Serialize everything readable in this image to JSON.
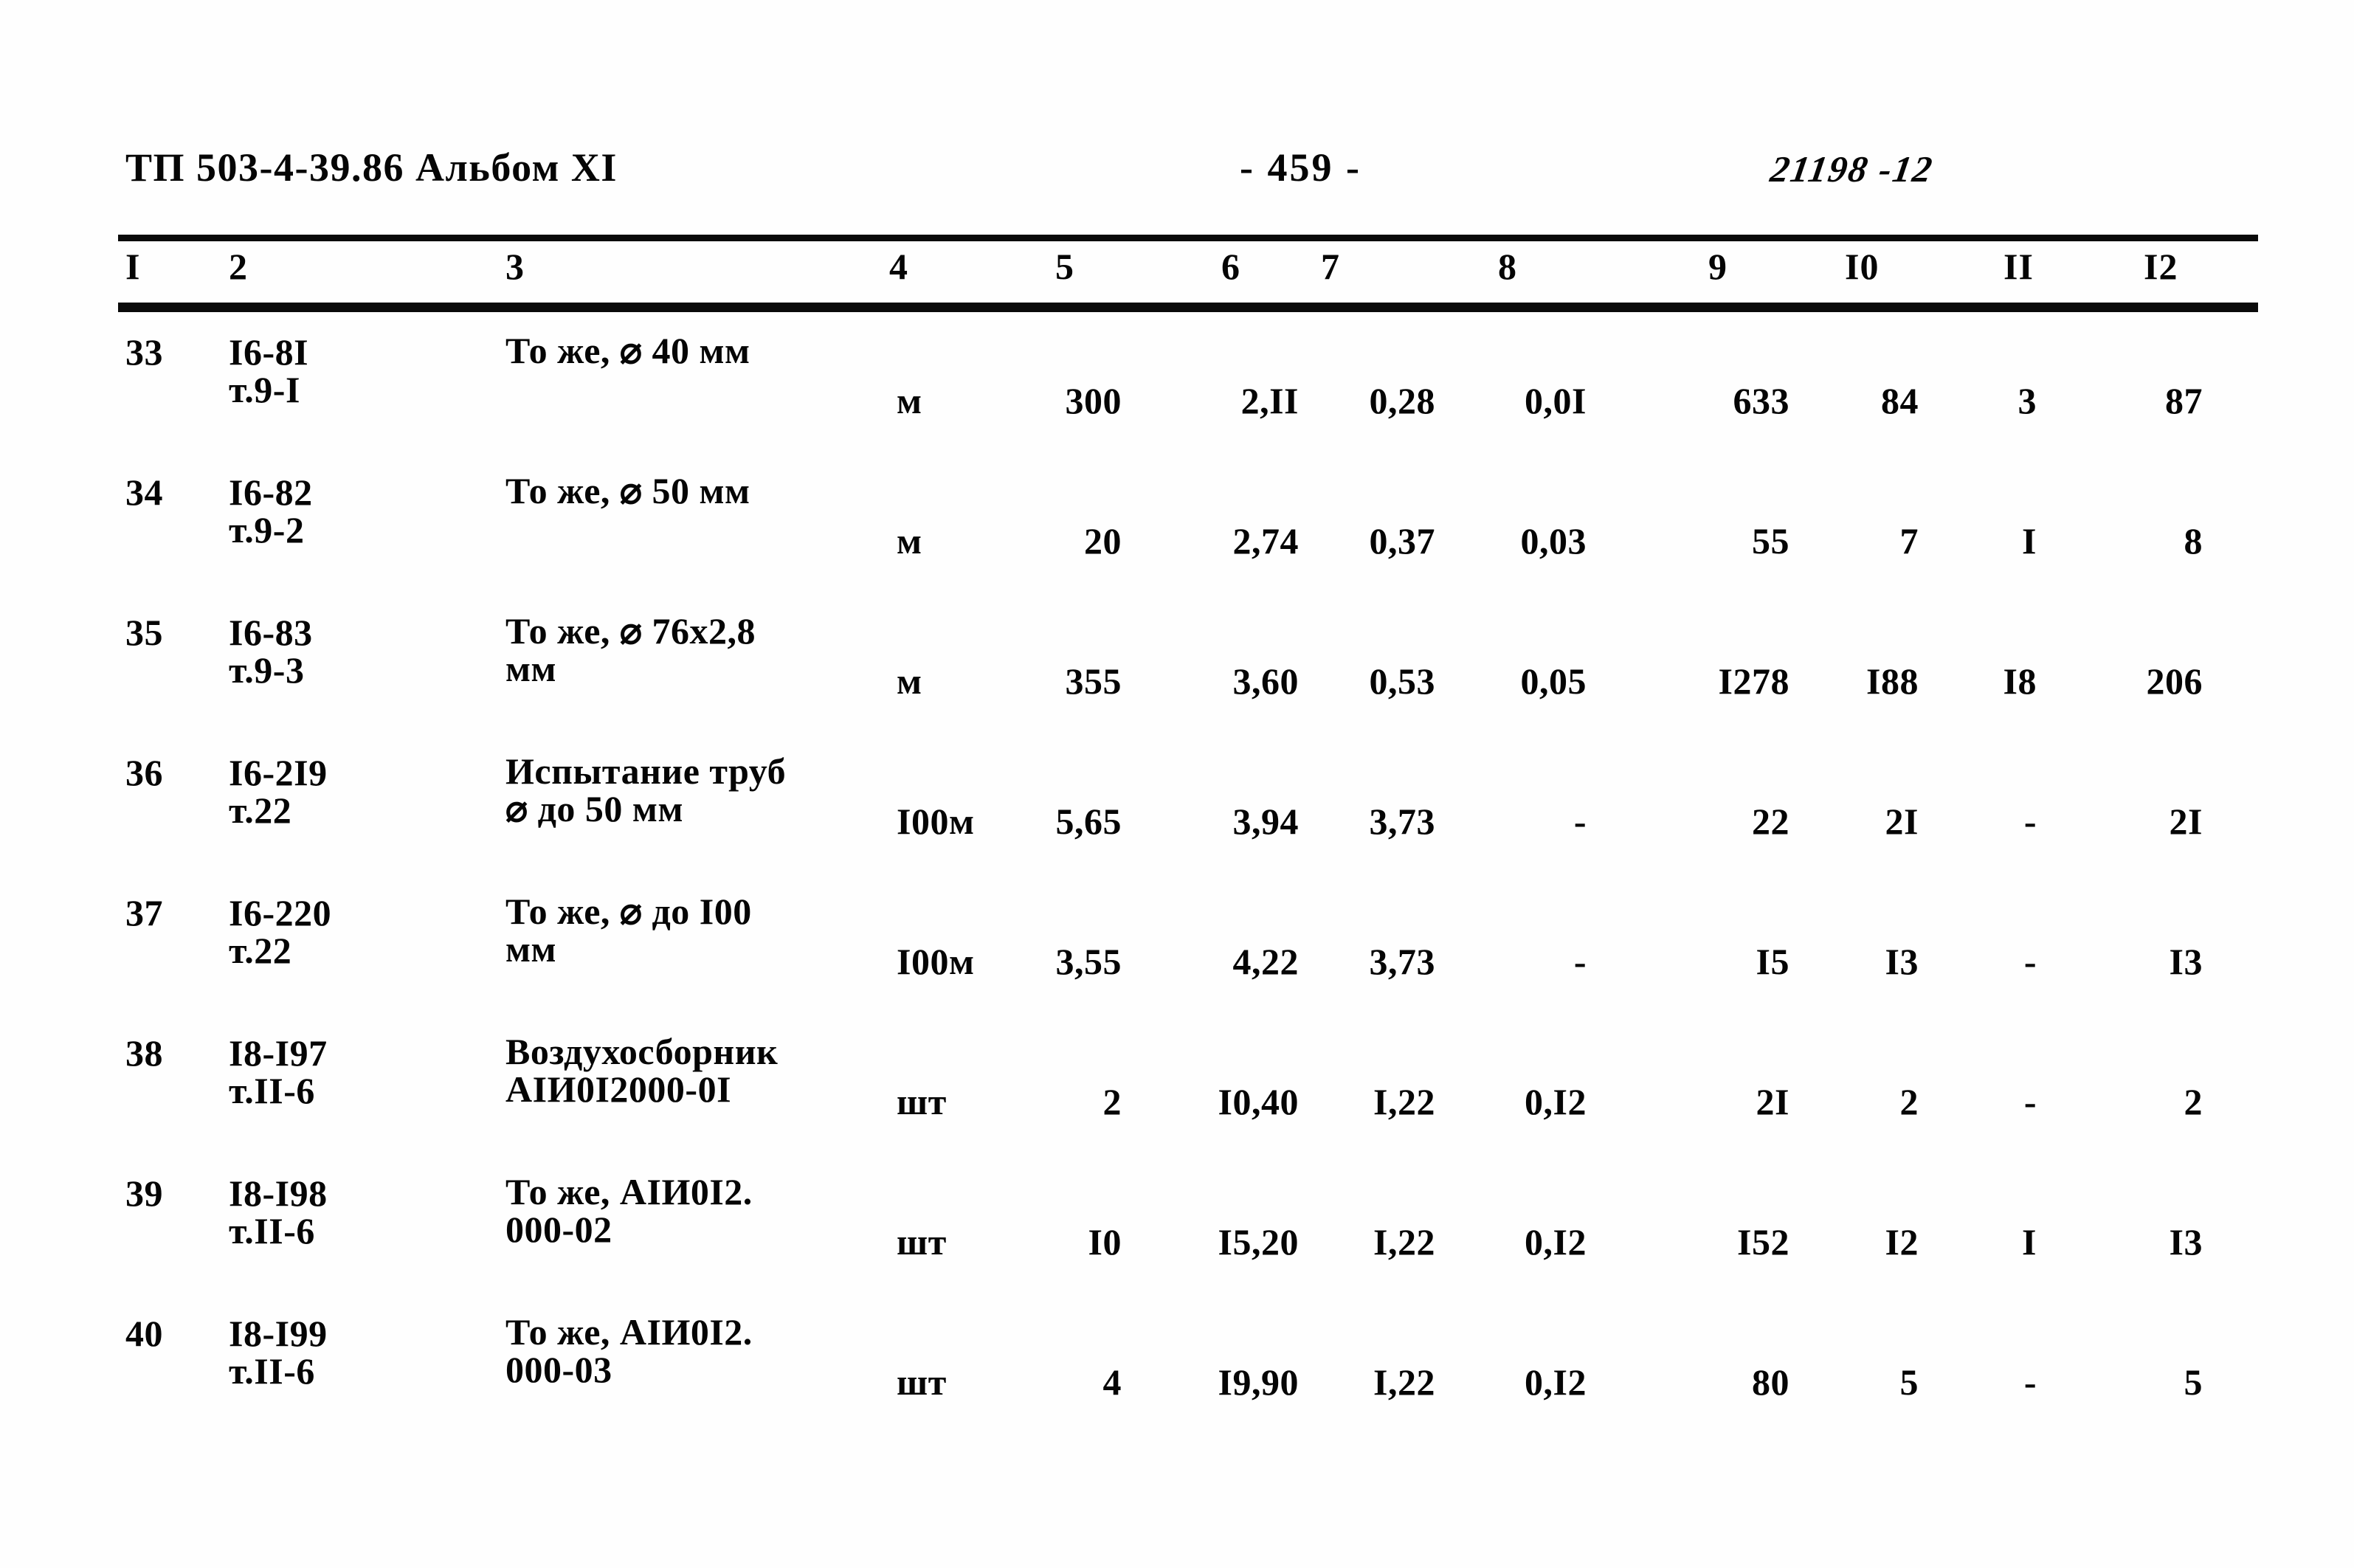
{
  "header": {
    "doc_code": "ТП 503-4-39.86 Альбом XI",
    "page_number": "- 459 -",
    "stamp_number": "21198 -12"
  },
  "table": {
    "column_headers": [
      "I",
      "2",
      "3",
      "4",
      "5",
      "6",
      "7",
      "8",
      "9",
      "I0",
      "II",
      "I2"
    ],
    "rows": [
      {
        "num": "33",
        "code_l1": "I6-8I",
        "code_l2": "т.9-I",
        "name_l1": "То же, ⌀ 40 мм",
        "name_l2": "",
        "unit": "м",
        "c5": "300",
        "c6": "2,II",
        "c7": "0,28",
        "c8": "0,0I",
        "c9": "633",
        "c10": "84",
        "c11": "3",
        "c12": "87"
      },
      {
        "num": "34",
        "code_l1": "I6-82",
        "code_l2": "т.9-2",
        "name_l1": "То же, ⌀ 50 мм",
        "name_l2": "",
        "unit": "м",
        "c5": "20",
        "c6": "2,74",
        "c7": "0,37",
        "c8": "0,03",
        "c9": "55",
        "c10": "7",
        "c11": "I",
        "c12": "8"
      },
      {
        "num": "35",
        "code_l1": "I6-83",
        "code_l2": "т.9-3",
        "name_l1": "То же, ⌀ 76х2,8",
        "name_l2": "мм",
        "unit": "м",
        "c5": "355",
        "c6": "3,60",
        "c7": "0,53",
        "c8": "0,05",
        "c9": "I278",
        "c10": "I88",
        "c11": "I8",
        "c12": "206"
      },
      {
        "num": "36",
        "code_l1": "I6-2I9",
        "code_l2": "т.22",
        "name_l1": "Испытание труб",
        "name_l2": "⌀ до 50 мм",
        "unit": "I00м",
        "c5": "5,65",
        "c6": "3,94",
        "c7": "3,73",
        "c8": "-",
        "c9": "22",
        "c10": "2I",
        "c11": "-",
        "c12": "2I"
      },
      {
        "num": "37",
        "code_l1": "I6-220",
        "code_l2": "т.22",
        "name_l1": "То же, ⌀ до I00",
        "name_l2": "мм",
        "unit": "I00м",
        "c5": "3,55",
        "c6": "4,22",
        "c7": "3,73",
        "c8": "-",
        "c9": "I5",
        "c10": "I3",
        "c11": "-",
        "c12": "I3"
      },
      {
        "num": "38",
        "code_l1": "I8-I97",
        "code_l2": "т.II-6",
        "name_l1": "Воздухосборник",
        "name_l2": "АIИ0I2000-0I",
        "unit": "шт",
        "c5": "2",
        "c6": "I0,40",
        "c7": "I,22",
        "c8": "0,I2",
        "c9": "2I",
        "c10": "2",
        "c11": "-",
        "c12": "2"
      },
      {
        "num": "39",
        "code_l1": "I8-I98",
        "code_l2": "т.II-6",
        "name_l1": "То же, АIИ0I2.",
        "name_l2": "000-02",
        "unit": "шт",
        "c5": "I0",
        "c6": "I5,20",
        "c7": "I,22",
        "c8": "0,I2",
        "c9": "I52",
        "c10": "I2",
        "c11": "I",
        "c12": "I3"
      },
      {
        "num": "40",
        "code_l1": "I8-I99",
        "code_l2": "т.II-6",
        "name_l1": "То же, АIИ0I2.",
        "name_l2": "000-03",
        "unit": "шт",
        "c5": "4",
        "c6": "I9,90",
        "c7": "I,22",
        "c8": "0,I2",
        "c9": "80",
        "c10": "5",
        "c11": "-",
        "c12": "5"
      }
    ]
  }
}
